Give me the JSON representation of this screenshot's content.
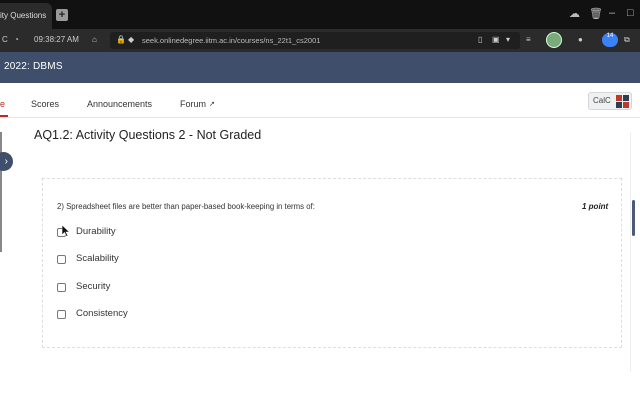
{
  "browser": {
    "tab_title": "ity Questions",
    "new_tab": "+",
    "time": "09:38:27 AM",
    "url": "seek.onlinedegree.iitm.ac.in/courses/ns_22t1_cs2001",
    "extension_badge": "14"
  },
  "app": {
    "course_title": "2022: DBMS"
  },
  "nav": {
    "items": [
      {
        "label": "e"
      },
      {
        "label": "Scores"
      },
      {
        "label": "Announcements"
      },
      {
        "label": "Forum"
      }
    ],
    "calc_label": "CalC"
  },
  "page": {
    "title": "AQ1.2: Activity Questions 2 - Not Graded"
  },
  "question": {
    "text": "2)  Spreadsheet files are better than paper-based book-keeping in terms of:",
    "points": "1 point",
    "options": [
      {
        "label": "Durability",
        "checked": false
      },
      {
        "label": "Scalability",
        "checked": false
      },
      {
        "label": "Security",
        "checked": false
      },
      {
        "label": "Consistency",
        "checked": false
      }
    ]
  },
  "colors": {
    "header": "#3f4f6b",
    "accent": "#c62828"
  }
}
